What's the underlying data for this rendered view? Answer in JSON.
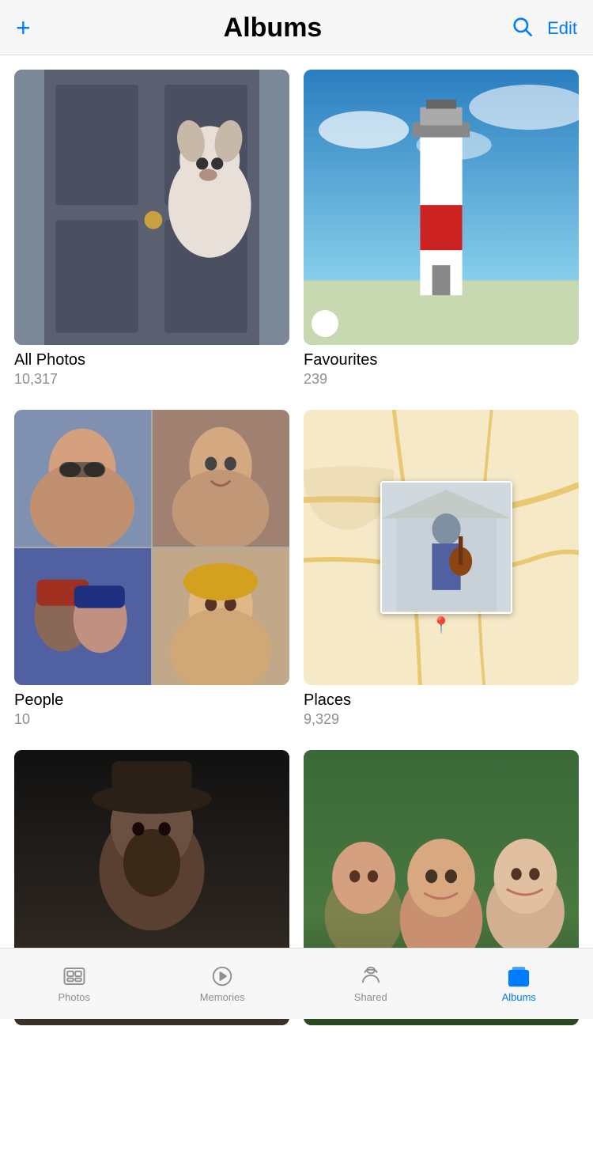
{
  "header": {
    "title": "Albums",
    "add_label": "+",
    "edit_label": "Edit",
    "search_icon": "search-icon"
  },
  "albums": [
    {
      "id": "all-photos",
      "title": "All Photos",
      "count": "10,317",
      "type": "single"
    },
    {
      "id": "favourites",
      "title": "Favourites",
      "count": "239",
      "type": "single",
      "has_heart": true
    },
    {
      "id": "people",
      "title": "People",
      "count": "10",
      "type": "people"
    },
    {
      "id": "places",
      "title": "Places",
      "count": "9,329",
      "type": "places"
    },
    {
      "id": "album-dark",
      "title": "",
      "count": "",
      "type": "single"
    },
    {
      "id": "album-group",
      "title": "",
      "count": "",
      "type": "single"
    }
  ],
  "bottom_nav": {
    "items": [
      {
        "id": "photos",
        "label": "Photos",
        "active": false
      },
      {
        "id": "memories",
        "label": "Memories",
        "active": false
      },
      {
        "id": "shared",
        "label": "Shared",
        "active": false
      },
      {
        "id": "albums",
        "label": "Albums",
        "active": true
      }
    ]
  }
}
